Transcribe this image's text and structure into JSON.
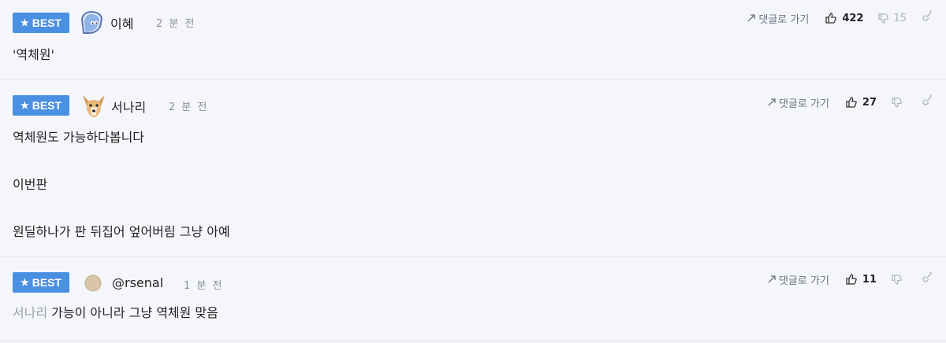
{
  "badge_label": "BEST",
  "reply_label": "댓글로 가기",
  "colors": {
    "badge": "#4a90e2",
    "background": "#f4f6fa",
    "muted": "#8a8f99"
  },
  "comments": [
    {
      "author": "이혜",
      "time": "2 분 전",
      "likes": "422",
      "dislikes": "15",
      "lines": [
        "'역체원'"
      ],
      "avatar": "blue-character-avatar"
    },
    {
      "author": "서나리",
      "time": "2 분 전",
      "likes": "27",
      "dislikes": "",
      "lines": [
        "역체원도 가능하다봅니다",
        "이번판",
        "원딜하나가 판 뒤집어 엎어버림 그냥 아예"
      ],
      "avatar": "dog-avatar"
    },
    {
      "author": "@rsenal",
      "time": "1 분 전",
      "likes": "11",
      "dislikes": "",
      "mention": "서나리",
      "lines": [
        "가능이 아니라 그냥 역체원 맞음"
      ],
      "avatar": "circle-avatar"
    }
  ]
}
